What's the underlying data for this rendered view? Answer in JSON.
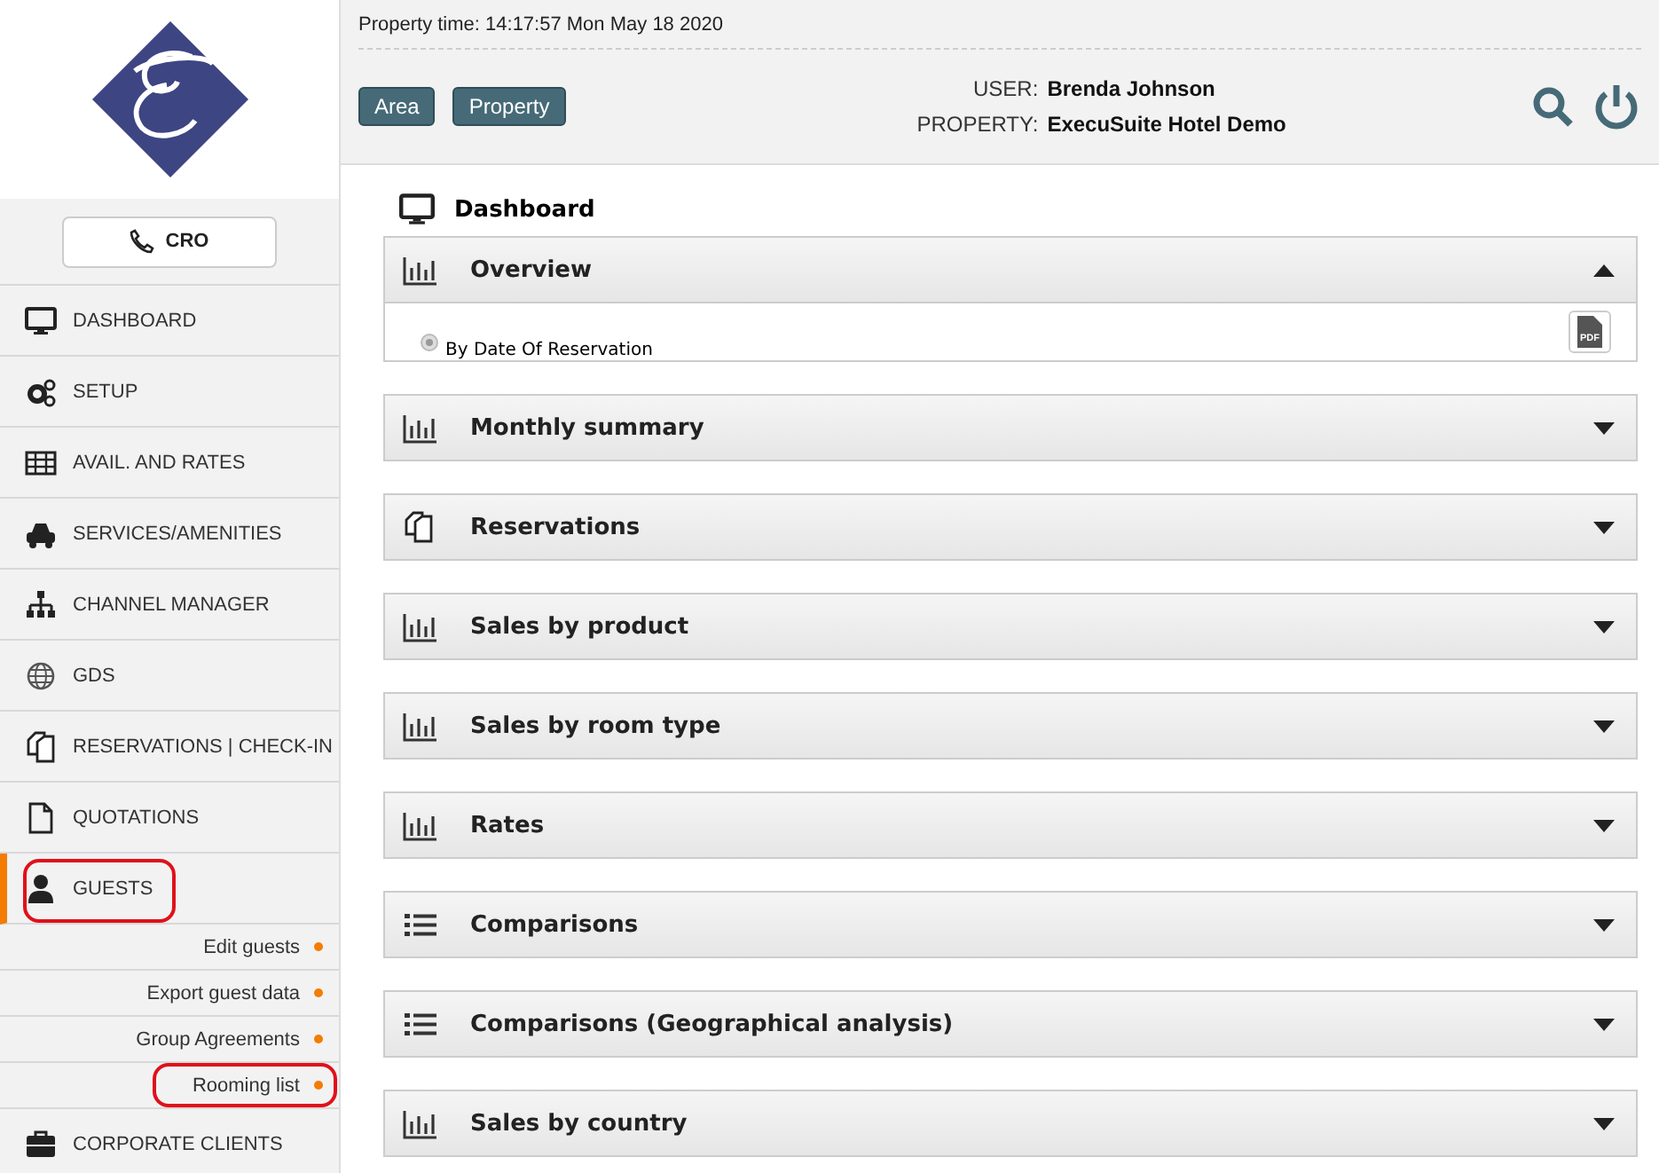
{
  "header": {
    "property_time": "Property time: 14:17:57 Mon May 18 2020",
    "buttons": [
      "Area",
      "Property"
    ],
    "user_label": "USER:",
    "user": "Brenda Johnson",
    "property_label": "PROPERTY:",
    "property": "ExecuSuite Hotel Demo"
  },
  "sidebar": {
    "cro_button": "CRO",
    "items": [
      {
        "label": "DASHBOARD",
        "kind": "monitor",
        "selected": false,
        "highlighted": false
      },
      {
        "label": "SETUP",
        "kind": "gears",
        "selected": false,
        "highlighted": false
      },
      {
        "label": "AVAIL. AND RATES",
        "kind": "grid",
        "selected": false,
        "highlighted": false
      },
      {
        "label": "SERVICES/AMENITIES",
        "kind": "car",
        "selected": false,
        "highlighted": false
      },
      {
        "label": "CHANNEL MANAGER",
        "kind": "sitemap",
        "selected": false,
        "highlighted": false
      },
      {
        "label": "GDS",
        "kind": "globe",
        "selected": false,
        "highlighted": false
      },
      {
        "label": "RESERVATIONS | CHECK-IN",
        "kind": "copy",
        "selected": false,
        "highlighted": false
      },
      {
        "label": "QUOTATIONS",
        "kind": "file",
        "selected": false,
        "highlighted": false
      },
      {
        "label": "GUESTS",
        "kind": "user",
        "selected": true,
        "highlighted": true,
        "children": [
          {
            "label": "Edit guests",
            "highlighted": false
          },
          {
            "label": "Export guest data",
            "highlighted": false
          },
          {
            "label": "Group Agreements",
            "highlighted": false
          },
          {
            "label": "Rooming list",
            "highlighted": true
          }
        ]
      },
      {
        "label": "CORPORATE CLIENTS",
        "kind": "briefcase",
        "selected": false,
        "highlighted": false
      }
    ]
  },
  "page_title": "Dashboard",
  "panels": [
    {
      "title": "Overview",
      "kind": "bars",
      "expanded": true,
      "option": "By Date Of Reservation",
      "option_selected": true,
      "pdf_label": "PDF"
    },
    {
      "title": "Monthly summary",
      "kind": "bars",
      "expanded": false
    },
    {
      "title": "Reservations",
      "kind": "copy",
      "expanded": false
    },
    {
      "title": "Sales by product",
      "kind": "bars",
      "expanded": false
    },
    {
      "title": "Sales by room type",
      "kind": "bars",
      "expanded": false
    },
    {
      "title": "Rates",
      "kind": "bars",
      "expanded": false
    },
    {
      "title": "Comparisons",
      "kind": "list",
      "expanded": false
    },
    {
      "title": "Comparisons (Geographical analysis)",
      "kind": "list",
      "expanded": false
    },
    {
      "title": "Sales by country",
      "kind": "bars",
      "expanded": false
    }
  ]
}
